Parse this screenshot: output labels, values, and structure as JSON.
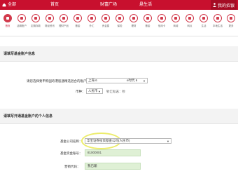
{
  "topbar": {
    "nav": [
      "全部",
      "首页",
      "财富广场",
      "悬生活"
    ],
    "user": "我的招银"
  },
  "iconbar": {
    "items": [
      {
        "label": "首页",
        "active": true
      },
      {
        "label": "活期账户"
      },
      {
        "label": "定期存款"
      },
      {
        "label": "财经资讯"
      },
      {
        "label": "理财产品"
      },
      {
        "label": "基金"
      },
      {
        "label": "外汇"
      },
      {
        "label": "贵金属"
      },
      {
        "label": "保险"
      },
      {
        "label": "理财"
      },
      {
        "label": "基金"
      },
      {
        "label": "信用卡"
      },
      {
        "label": "商城"
      },
      {
        "label": "网点"
      },
      {
        "label": "生活"
      },
      {
        "label": "本地生活"
      },
      {
        "label": "更多"
      }
    ]
  },
  "section1": {
    "title": "请填写基金账户信息",
    "account_label": "请您选择要申购国寿港股通精选混合的账户：",
    "account_value": "上海 6",
    "account_suffix": "e时代 6",
    "currency_label": "币种：",
    "currency_value": "人民币",
    "currency_hint": "钞汇标志：钞"
  },
  "section2": {
    "title": "请填写开通基金账户的个人信息",
    "company_label": "基金公司名称：",
    "company_value": "华宝证券投资基金公司(人民币)",
    "account_no_label": "基金资金账号：",
    "account_no_value": "81000001",
    "code_label": "营销代码：",
    "code_value": "我已输"
  }
}
